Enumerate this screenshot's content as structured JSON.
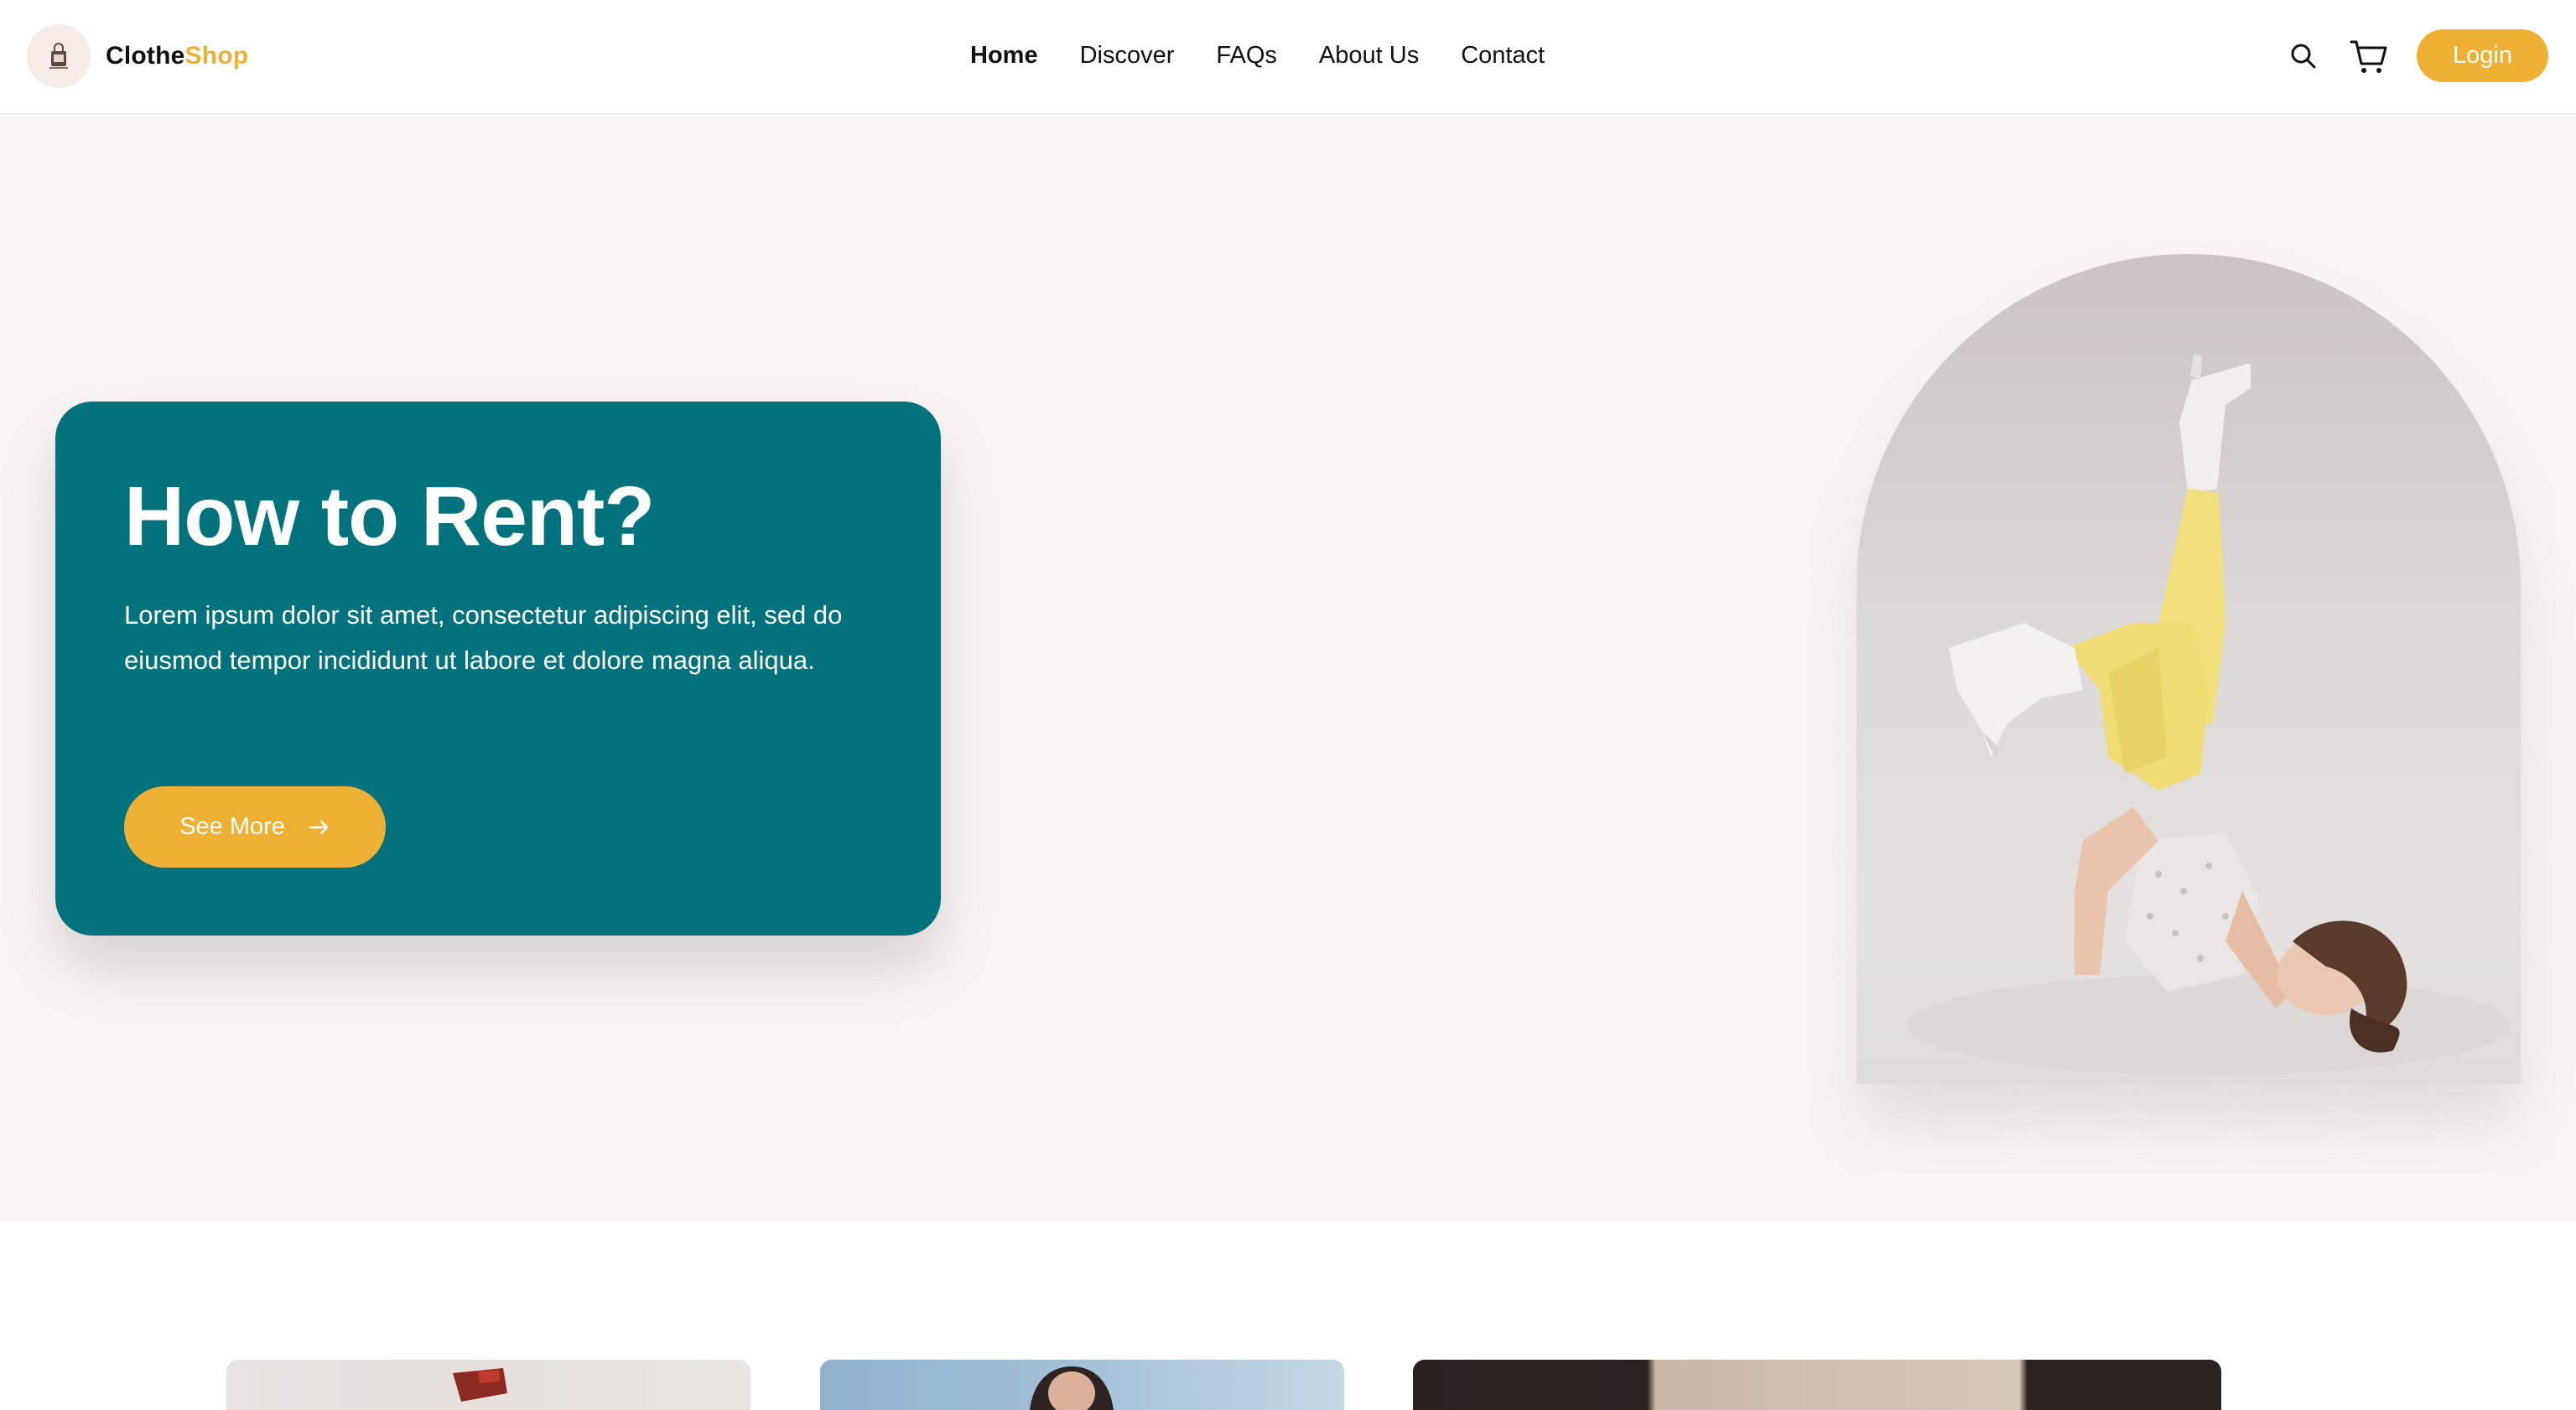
{
  "brand": {
    "name_part1": "Clothe",
    "name_part2": "Shop",
    "logo_icon": "shop-bag-icon",
    "accent_color": "#efb134"
  },
  "nav": {
    "links": [
      {
        "label": "Home",
        "active": true
      },
      {
        "label": "Discover",
        "active": false
      },
      {
        "label": "FAQs",
        "active": false
      },
      {
        "label": "About Us",
        "active": false
      },
      {
        "label": "Contact",
        "active": false
      }
    ],
    "search_icon": "search-icon",
    "cart_icon": "cart-icon",
    "login_label": "Login"
  },
  "hero": {
    "card_color": "#02727c",
    "title": "How to Rent?",
    "text": "Lorem ipsum dolor sit amet, consectetur adipiscing elit, sed do eiusmod tempor incididunt ut labore et dolore magna aliqua.",
    "button_label": "See More",
    "button_icon": "arrow-right-icon",
    "image_alt": "fashion-model-photo"
  },
  "products": {
    "cards": [
      "product-card-1",
      "product-card-2",
      "product-card-3"
    ]
  }
}
